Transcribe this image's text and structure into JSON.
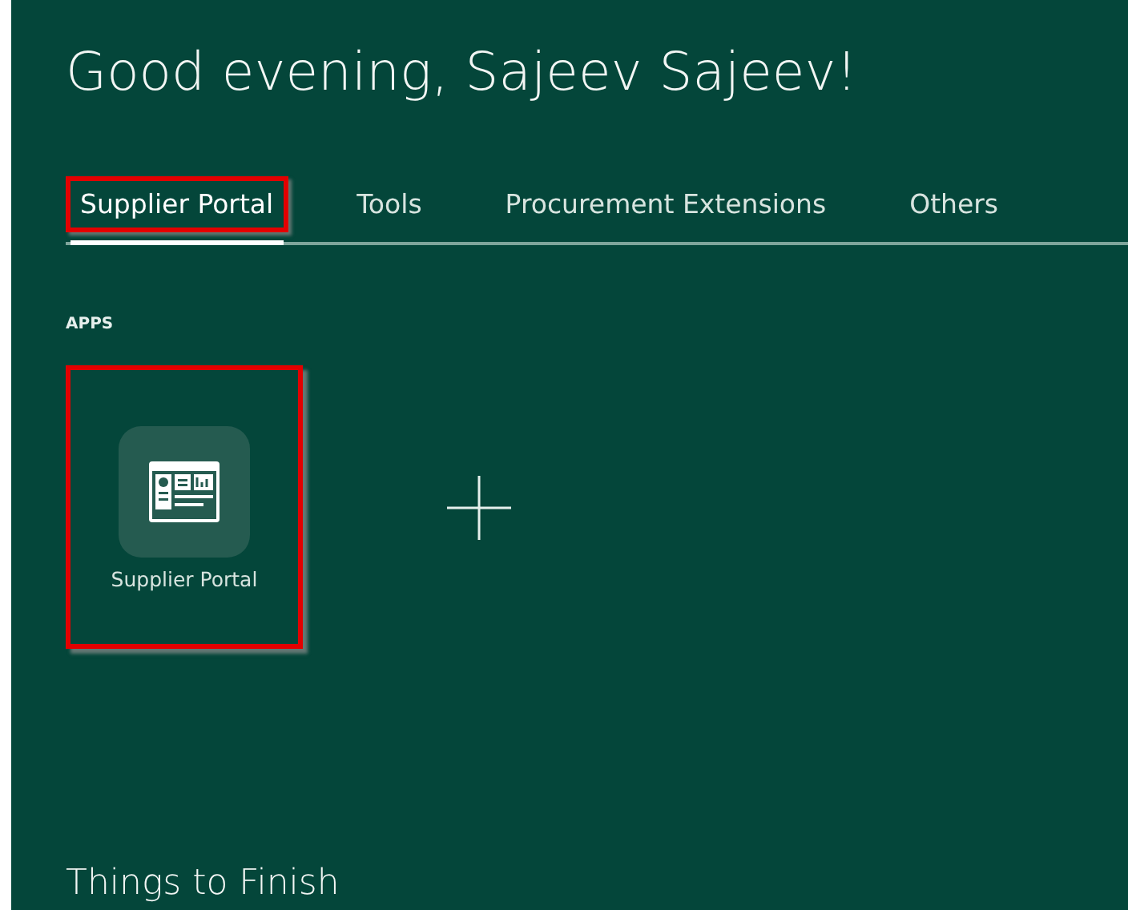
{
  "greeting": "Good evening, Sajeev Sajeev!",
  "tabs": [
    {
      "label": "Supplier Portal",
      "selected": true,
      "highlighted": true
    },
    {
      "label": "Tools",
      "selected": false,
      "highlighted": false
    },
    {
      "label": "Procurement Extensions",
      "selected": false,
      "highlighted": false
    },
    {
      "label": "Others",
      "selected": false,
      "highlighted": false
    }
  ],
  "apps_heading": "APPS",
  "apps": [
    {
      "label": "Supplier Portal",
      "highlighted": true
    }
  ],
  "section_title": "Things to Finish"
}
